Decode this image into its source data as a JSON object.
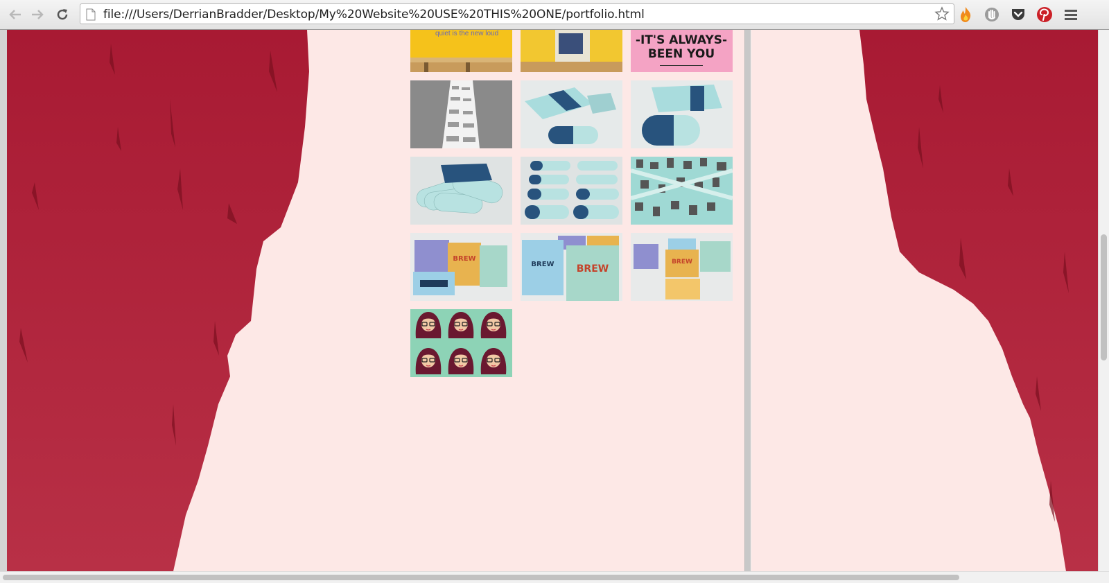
{
  "browser": {
    "url": "file:///Users/DerrianBradder/Desktop/My%20Website%20USE%20THIS%20ONE/portfolio.html",
    "icons": [
      "back-arrow-icon",
      "forward-arrow-icon",
      "reload-icon",
      "page-icon",
      "bookmark-star-icon",
      "flame-extension-icon",
      "hand-extension-icon",
      "pocket-icon",
      "pinterest-icon",
      "menu-icon"
    ]
  },
  "colors": {
    "page_background": "#fde8e6",
    "paint_red": "#b22038",
    "chrome": "#e6e6e6"
  },
  "portfolio": {
    "thumbnails": [
      {
        "id": "yellow-room-quiet",
        "text_top": "quiet is the new loud"
      },
      {
        "id": "yellow-room-board"
      },
      {
        "id": "always-been-you-poster",
        "text_top": "-IT'S ALWAYS-",
        "text_bottom": "BEEN YOU"
      },
      {
        "id": "timeline-strip"
      },
      {
        "id": "blue-card-packs-1"
      },
      {
        "id": "blue-card-packs-2"
      },
      {
        "id": "card-fan"
      },
      {
        "id": "card-rows"
      },
      {
        "id": "mint-print-collage"
      },
      {
        "id": "emergency-brew-boxes-1"
      },
      {
        "id": "emergency-brew-boxes-2"
      },
      {
        "id": "emergency-brew-boxes-3"
      },
      {
        "id": "girl-pattern-illustration"
      }
    ]
  }
}
